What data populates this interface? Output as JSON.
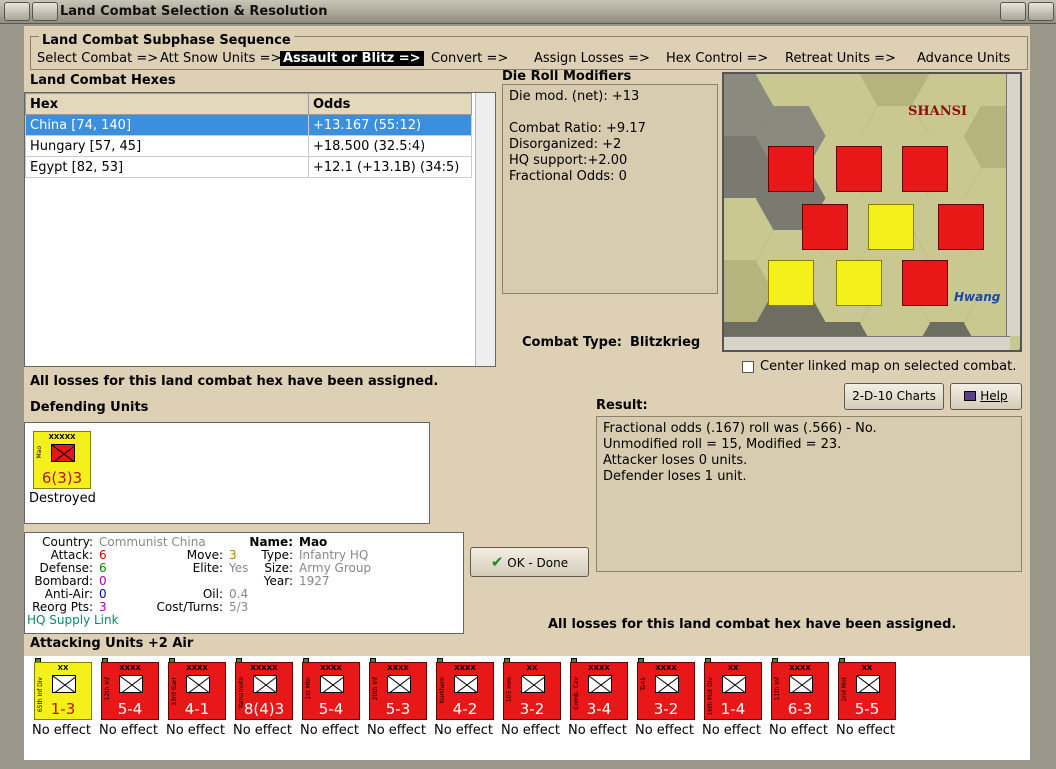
{
  "window": {
    "title": "Land Combat Selection & Resolution"
  },
  "subphase": {
    "title": "Land Combat Subphase Sequence",
    "steps": [
      "Select Combat =>",
      "Att Snow Units =>",
      "Assault or Blitz =>",
      "Convert =>",
      "Assign Losses =>",
      "Hex Control =>",
      "Retreat Units =>",
      "Advance Units"
    ],
    "active_index": 2
  },
  "hexes": {
    "title": "Land Combat Hexes",
    "columns": [
      "Hex",
      "Odds"
    ],
    "rows": [
      {
        "hex": "China [74, 140]",
        "odds": "+13.167 (55:12)"
      },
      {
        "hex": "Hungary [57, 45]",
        "odds": "+18.500 (32.5:4)"
      },
      {
        "hex": "Egypt [82, 53]",
        "odds": "+12.1 (+13.1B) (34:5)"
      }
    ]
  },
  "die_roll": {
    "title": "Die Roll Modifiers",
    "lines": [
      "Die mod. (net): +13",
      "",
      "Combat Ratio: +9.17",
      "Disorganized: +2",
      "HQ support:+2.00",
      "Fractional Odds: 0"
    ]
  },
  "map": {
    "region_label": "SHANSI",
    "river_label": "Hwang",
    "center_checkbox": "Center linked map on selected combat."
  },
  "combat_type": {
    "label": "Combat Type:",
    "value": "Blitzkrieg"
  },
  "losses_msg": "All losses for this land combat hex have been assigned.",
  "buttons": {
    "charts": "2-D-10 Charts",
    "help": "Help",
    "ok": "OK - Done"
  },
  "defending": {
    "title": "Defending Units",
    "units": [
      {
        "size": "XXXXX",
        "name": "Mao",
        "strength": "6(3)3",
        "outcome": "Destroyed"
      }
    ]
  },
  "result": {
    "title": "Result:",
    "lines": [
      "Fractional odds (.167) roll was (.566)  - No.",
      "Unmodified roll = 15, Modified = 23.",
      "Attacker loses 0 units.",
      "Defender loses 1 unit."
    ]
  },
  "info": {
    "country_label": "Country:",
    "country": "Communist China",
    "attack_label": "Attack:",
    "attack": "6",
    "defense_label": "Defense:",
    "defense": "6",
    "bombard_label": "Bombard:",
    "bombard": "0",
    "antiair_label": "Anti-Air:",
    "antiair": "0",
    "reorg_label": "Reorg Pts:",
    "reorg": "3",
    "supply": "HQ Supply Link",
    "move_label": "Move:",
    "move": "3",
    "elite_label": "Elite:",
    "elite": "Yes",
    "oil_label": "Oil:",
    "oil": "0.4",
    "cost_label": "Cost/Turns:",
    "cost": "5/3",
    "name_label": "Name:",
    "name": "Mao",
    "type_label": "Type:",
    "type": "Infantry HQ",
    "size_label": "Size:",
    "size": "Army Group",
    "year_label": "Year:",
    "year": "1927"
  },
  "attacking": {
    "title": "Attacking Units +2 Air",
    "units": [
      {
        "size": "XX",
        "name": "65th Inf Div",
        "strength": "1-3",
        "outcome": "No effect",
        "color": "yellow"
      },
      {
        "size": "XXXX",
        "name": "12th Inf",
        "strength": "5-4",
        "outcome": "No effect",
        "color": "red"
      },
      {
        "size": "XXXX",
        "name": "33rd Garr",
        "strength": "4-1",
        "outcome": "No effect",
        "color": "red"
      },
      {
        "size": "XXXXX",
        "name": "Yamamoto",
        "strength": "8(4)3",
        "outcome": "No effect",
        "color": "red"
      },
      {
        "size": "XXXX",
        "name": "1st Mtn",
        "strength": "5-4",
        "outcome": "No effect",
        "color": "red"
      },
      {
        "size": "XXXX",
        "name": "20th Inf",
        "strength": "5-3",
        "outcome": "No effect",
        "color": "red"
      },
      {
        "size": "XXXX",
        "name": "Northern",
        "strength": "4-2",
        "outcome": "No effect",
        "color": "red"
      },
      {
        "size": "XX",
        "name": "105 mm",
        "strength": "3-2",
        "outcome": "No effect",
        "color": "red"
      },
      {
        "size": "XXXX",
        "name": "Comb. Cav",
        "strength": "3-4",
        "outcome": "No effect",
        "color": "red"
      },
      {
        "size": "XXXX",
        "name": "Tank",
        "strength": "3-2",
        "outcome": "No effect",
        "color": "red"
      },
      {
        "size": "XX",
        "name": "16th Mot Div",
        "strength": "1-4",
        "outcome": "No effect",
        "color": "red"
      },
      {
        "size": "XXXX",
        "name": "11th Inf",
        "strength": "6-3",
        "outcome": "No effect",
        "color": "red"
      },
      {
        "size": "XX",
        "name": "2nd Mot",
        "strength": "5-5",
        "outcome": "No effect",
        "color": "red"
      }
    ]
  }
}
